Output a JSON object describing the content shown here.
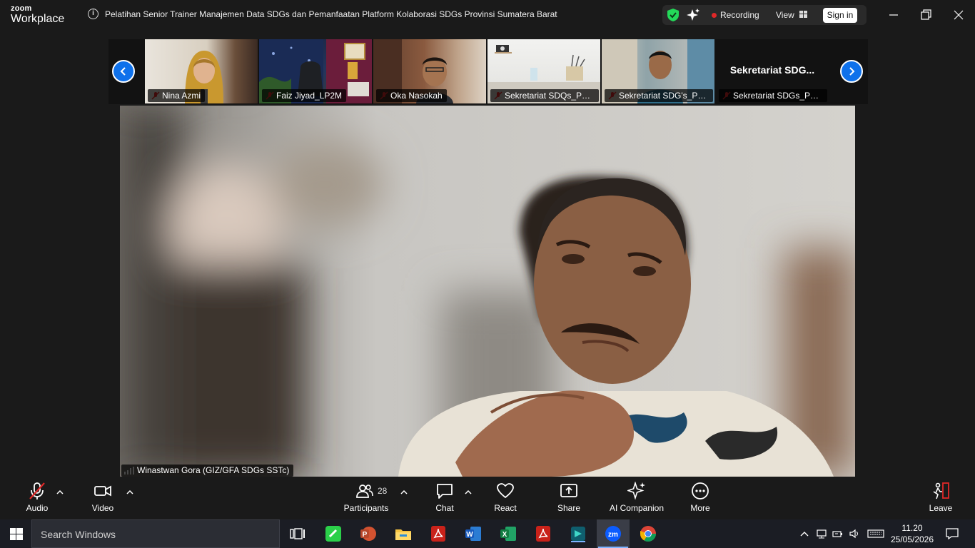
{
  "app": {
    "logo_top": "zoom",
    "logo_bottom": "Workplace",
    "meeting_title": "Pelatihan Senior Trainer Manajemen Data SDGs dan Pemanfaatan Platform Kolaborasi SDGs Provinsi Sumatera Barat",
    "recording_label": "Recording",
    "view_label": "View",
    "signin_label": "Sign in"
  },
  "participants_strip": [
    {
      "name": "Nina Azmi",
      "muted": true
    },
    {
      "name": "Faiz Jiyad_LP2M",
      "muted": true
    },
    {
      "name": "Oka Nasokah",
      "muted": true
    },
    {
      "name": "Sekretariat SDQs_Pes...",
      "muted": true
    },
    {
      "name": "Sekretariat SDG's_Pes...",
      "muted": true
    },
    {
      "name": "Sekretariat SDGs_Pes...",
      "muted": true,
      "display_name": "Sekretariat  SDG..."
    }
  ],
  "main_speaker": {
    "name": "Winastwan Gora (GIZ/GFA SDGs SSTc)"
  },
  "toolbar": {
    "audio": "Audio",
    "video": "Video",
    "participants": "Participants",
    "participants_count": "28",
    "chat": "Chat",
    "react": "React",
    "share": "Share",
    "ai_companion": "AI Companion",
    "more": "More",
    "leave": "Leave"
  },
  "taskbar": {
    "search_placeholder": "Search Windows",
    "time": "11.20",
    "date": "25/05/2026"
  },
  "colors": {
    "accent": "#0e71eb",
    "recording": "#e02828",
    "muted_mic": "#e02828",
    "leave": "#e02828"
  }
}
